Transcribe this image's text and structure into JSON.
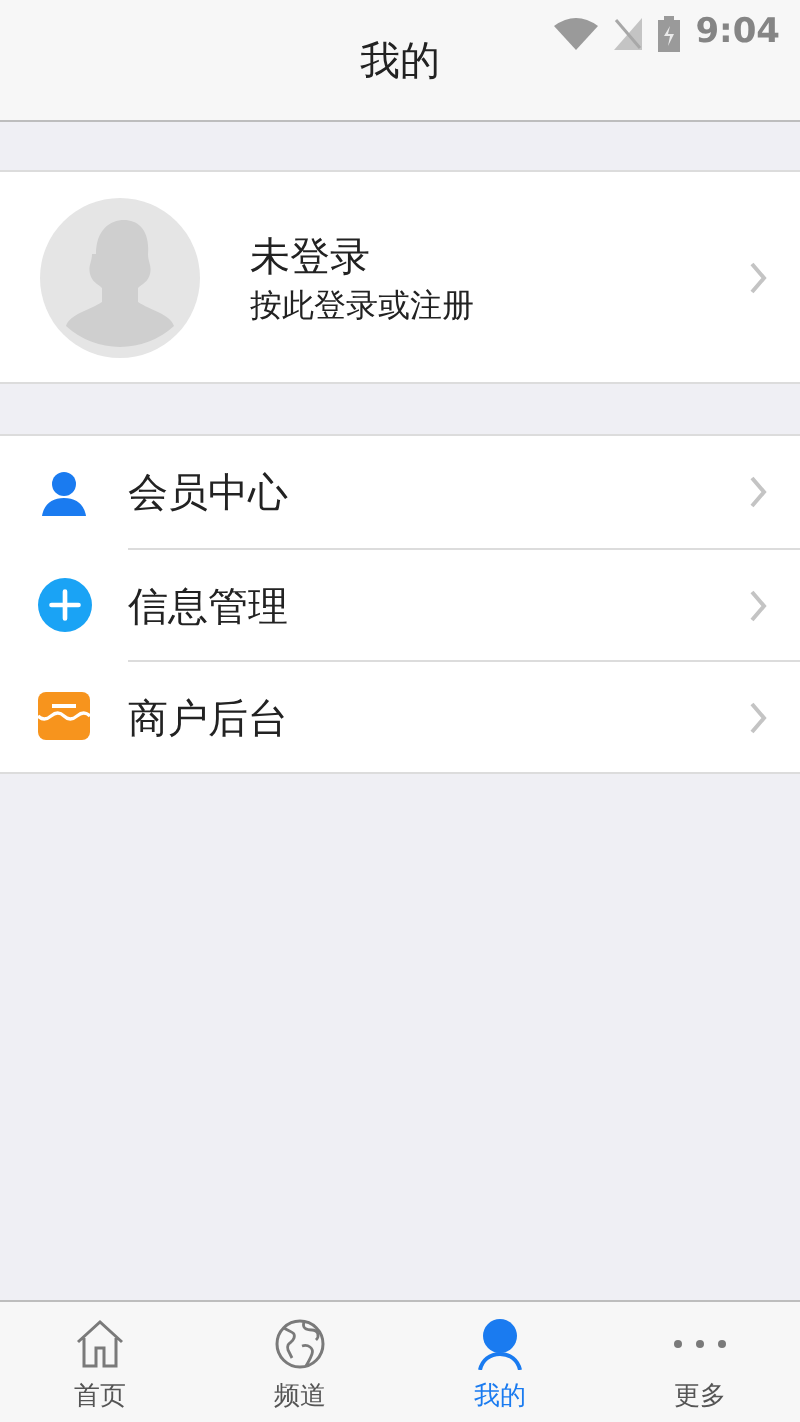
{
  "status_bar": {
    "time": "9:04"
  },
  "header": {
    "title": "我的"
  },
  "profile": {
    "name": "未登录",
    "hint": "按此登录或注册"
  },
  "menu": [
    {
      "label": "会员中心",
      "kind": "member"
    },
    {
      "label": "信息管理",
      "kind": "info"
    },
    {
      "label": "商户后台",
      "kind": "shop"
    }
  ],
  "tabs": [
    {
      "label": "首页",
      "kind": "home",
      "selected": false
    },
    {
      "label": "频道",
      "kind": "globe",
      "selected": false
    },
    {
      "label": "我的",
      "kind": "me",
      "selected": true
    },
    {
      "label": "更多",
      "kind": "more",
      "selected": false
    }
  ]
}
